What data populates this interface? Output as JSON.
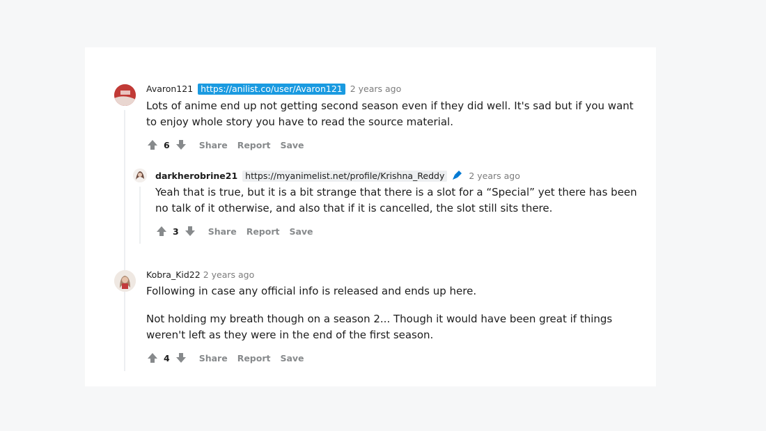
{
  "comments": [
    {
      "username": "Avaron121",
      "flair": "https://anilist.co/user/Avaron121",
      "time": "2 years ago",
      "lines": [
        "Lots of anime end up not getting second season even if they did well. It's sad but if you want",
        "to enjoy whole story you have to read the source material."
      ],
      "votes": "6",
      "actions": {
        "share": "Share",
        "report": "Report",
        "save": "Save"
      }
    },
    {
      "username": "darkherobrine21",
      "flair": "https://myanimelist.net/profile/Krishna_Reddy",
      "time": "2 years ago",
      "lines": [
        "Yeah that is true, but it is a bit strange that there is a slot for a “Special” yet there has been",
        "no talk of it otherwise, and also that if it is cancelled, the slot still sits there."
      ],
      "votes": "3",
      "actions": {
        "share": "Share",
        "report": "Report",
        "save": "Save"
      }
    },
    {
      "username": "Kobra_Kid22",
      "time": "2 years ago",
      "paragraph1": "Following in case any official info is released and ends up here.",
      "paragraph2_lines": [
        "Not holding my breath though on a season 2... Though it would have been great if things",
        "weren't left as they were in the end of the first season."
      ],
      "votes": "4",
      "actions": {
        "share": "Share",
        "report": "Report",
        "save": "Save"
      }
    }
  ],
  "colors": {
    "flair_blue": "#1a9ae0",
    "flair_gray": "#edeff1",
    "mod_icon": "#0079d3",
    "muted": "#878a8c"
  },
  "icons": {
    "upvote": "upvote-arrow-icon",
    "downvote": "downvote-arrow-icon",
    "mod": "microphone-icon"
  }
}
